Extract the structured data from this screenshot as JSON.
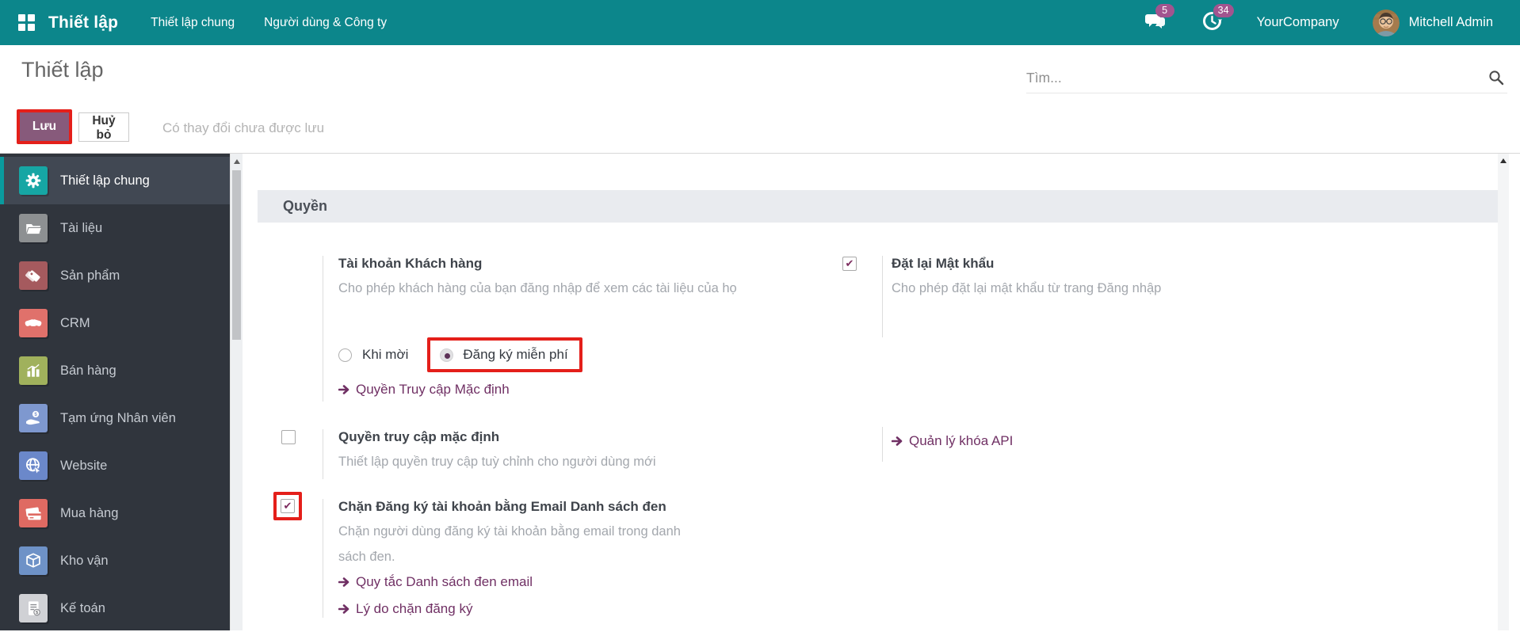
{
  "topbar": {
    "app_name": "Thiết lập",
    "menu_general": "Thiết lập chung",
    "menu_users": "Người dùng & Công ty",
    "messages_badge": "5",
    "activities_badge": "34",
    "company": "YourCompany",
    "user": "Mitchell Admin"
  },
  "control_panel": {
    "title": "Thiết lập",
    "save_label": "Lưu",
    "discard_label": "Huỷ bỏ",
    "unsaved_note": "Có thay đổi chưa được lưu",
    "search_placeholder": "Tìm..."
  },
  "sidebar": {
    "items": [
      {
        "name": "general-settings",
        "label": "Thiết lập chung",
        "icon": "gear-icon",
        "color": "#16a6a4",
        "active": true
      },
      {
        "name": "documents",
        "label": "Tài liệu",
        "icon": "folder-icon",
        "color": "#8d9092",
        "active": false
      },
      {
        "name": "products",
        "label": "Sản phẩm",
        "icon": "tags-icon",
        "color": "#a55a5e",
        "active": false
      },
      {
        "name": "crm",
        "label": "CRM",
        "icon": "handshake-icon",
        "color": "#e0716b",
        "active": false
      },
      {
        "name": "sales",
        "label": "Bán hàng",
        "icon": "bar-chart-icon",
        "color": "#a0b15c",
        "active": false
      },
      {
        "name": "employee-advance",
        "label": "Tạm ứng Nhân viên",
        "icon": "hand-coin-icon",
        "color": "#7e98cf",
        "active": false
      },
      {
        "name": "website",
        "label": "Website",
        "icon": "globe-icon",
        "color": "#6b88ca",
        "active": false
      },
      {
        "name": "purchase",
        "label": "Mua hàng",
        "icon": "credit-card-icon",
        "color": "#df6a62",
        "active": false
      },
      {
        "name": "inventory",
        "label": "Kho vận",
        "icon": "box-icon",
        "color": "#6e92c7",
        "active": false
      },
      {
        "name": "accounting",
        "label": "Kế toán",
        "icon": "invoice-icon",
        "color": "#d0d1d5",
        "active": false
      }
    ]
  },
  "content": {
    "section_title": "Quyền",
    "customer_account": {
      "title": "Tài khoản Khách hàng",
      "desc": "Cho phép khách hàng của bạn đăng nhập để xem các tài liệu của họ",
      "radio_invite": "Khi mời",
      "radio_free": "Đăng ký miễn phí",
      "selected_radio": "Đăng ký miễn phí",
      "link": "Quyền Truy cập Mặc định"
    },
    "reset_password": {
      "checked": true,
      "title": "Đặt lại Mật khẩu",
      "desc": "Cho phép đặt lại mật khẩu từ trang Đăng nhập"
    },
    "default_access": {
      "checked": false,
      "title": "Quyền truy cập mặc định",
      "desc": "Thiết lập quyền truy cập tuỳ chỉnh cho người dùng mới"
    },
    "api_keys_link": "Quản lý khóa API",
    "blacklist": {
      "checked": true,
      "title": "Chặn Đăng ký tài khoản bằng Email Danh sách đen",
      "desc": "Chặn người dùng đăng ký tài khoản bằng email trong danh sách đen.",
      "link_rules": "Quy tắc Danh sách đen email",
      "link_reasons": "Lý do chặn đăng ký"
    }
  },
  "colors": {
    "topbar_teal": "#0c868b",
    "primary_purple": "#875a7b",
    "link_purple": "#703064",
    "badge_pink": "#a2548f",
    "highlight_red": "#e41f1a",
    "sidebar_dark": "#30353d",
    "section_band": "#e9ebef"
  }
}
